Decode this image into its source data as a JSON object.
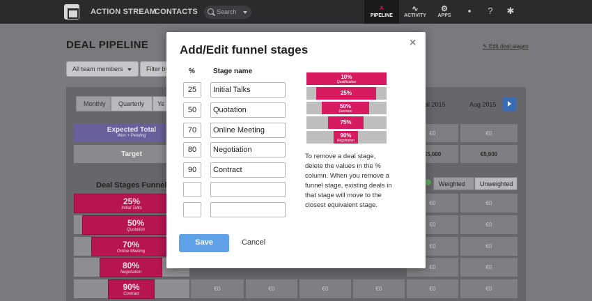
{
  "nav": {
    "links": [
      "ACTION STREAM",
      "CONTACTS"
    ],
    "search_placeholder": "Search",
    "tabs": [
      {
        "label": "PIPELINE",
        "icon": "funnel-icon",
        "glyph": "⩡",
        "active": true
      },
      {
        "label": "ACTIVITY",
        "icon": "pulse-icon",
        "glyph": "∿",
        "active": false
      },
      {
        "label": "APPS",
        "icon": "apps-icon",
        "glyph": "⚙",
        "active": false
      }
    ],
    "right_icons": [
      "chat-icon",
      "help-icon",
      "settings-icon"
    ]
  },
  "page": {
    "title": "DEAL PIPELINE",
    "edit_link": "Edit deal stages",
    "filter_members": "All team members",
    "filter_by": "Filter by",
    "period_tabs": [
      "Monthly",
      "Quarterly",
      "Ye"
    ],
    "months": [
      "al 2015",
      "Aug 2015"
    ],
    "expected_total": {
      "title": "Expected Total",
      "sub": "Won + Pending"
    },
    "target": "Target",
    "cell_values": [
      "€0",
      "€0",
      "€5,000",
      "€5,000"
    ],
    "funnel_title": "Deal Stages Funnel",
    "weighted": "Weighted",
    "unweighted": "Unweighted",
    "empty_cell": "€0"
  },
  "funnel_bg": [
    {
      "pct": "25%",
      "name": "Initial Talks"
    },
    {
      "pct": "50%",
      "name": "Quotation"
    },
    {
      "pct": "70%",
      "name": "Online Meeting"
    },
    {
      "pct": "80%",
      "name": "Negotiation"
    },
    {
      "pct": "90%",
      "name": "Contract"
    }
  ],
  "modal": {
    "title": "Add/Edit funnel stages",
    "close": "×",
    "col_pct": "%",
    "col_name": "Stage name",
    "rows": [
      {
        "pct": "25",
        "name": "Initial Talks"
      },
      {
        "pct": "50",
        "name": "Quotation"
      },
      {
        "pct": "70",
        "name": "Online Meeting"
      },
      {
        "pct": "80",
        "name": "Negotiation"
      },
      {
        "pct": "90",
        "name": "Contract"
      },
      {
        "pct": "",
        "name": ""
      },
      {
        "pct": "",
        "name": ""
      }
    ],
    "preview": [
      {
        "pct": "10%",
        "label": "Qualification"
      },
      {
        "pct": "25%",
        "label": ""
      },
      {
        "pct": "50%",
        "label": "Decision"
      },
      {
        "pct": "75%",
        "label": ""
      },
      {
        "pct": "90%",
        "label": "Negotiation"
      }
    ],
    "help_text": "To remove a deal stage, delete the values in the % column. When you remove a funnel stage, existing deals in that stage will move to the closest equivalent stage.",
    "save": "Save",
    "cancel": "Cancel"
  }
}
